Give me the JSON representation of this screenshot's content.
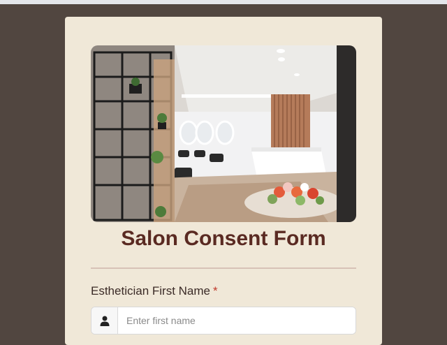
{
  "form": {
    "title": "Salon Consent Form",
    "hero_image": "salon-interior-photo",
    "fields": [
      {
        "label": "Esthetician First Name",
        "required_marker": "*",
        "icon": "user-icon",
        "value": "",
        "placeholder": "Enter first name"
      }
    ]
  },
  "colors": {
    "page_background": "#514640",
    "card_background": "#f0e8d8",
    "title_color": "#5a2a22",
    "required_color": "#c0392b"
  }
}
